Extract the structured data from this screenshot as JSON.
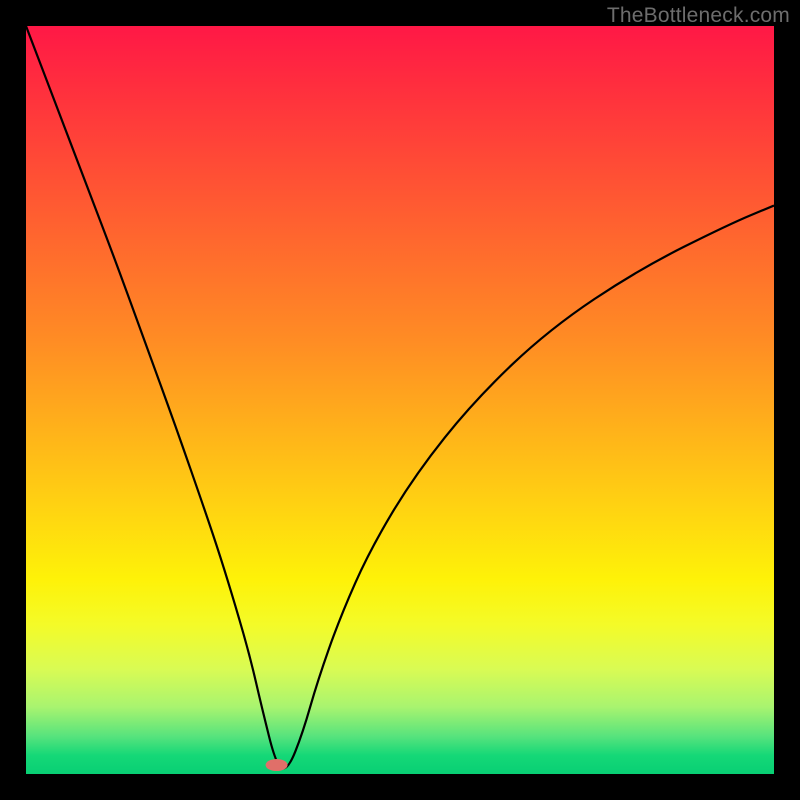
{
  "watermark": "TheBottleneck.com",
  "chart_data": {
    "type": "line",
    "title": "",
    "xlabel": "",
    "ylabel": "",
    "xlim": [
      0,
      100
    ],
    "ylim": [
      0,
      100
    ],
    "grid": false,
    "series": [
      {
        "name": "curve",
        "x": [
          0,
          4,
          8,
          12,
          16,
          20,
          24,
          26,
          28,
          30,
          31.5,
          33.5,
          35,
          37,
          39,
          42,
          46,
          52,
          60,
          70,
          82,
          94,
          100
        ],
        "y": [
          100,
          89.5,
          79,
          68.5,
          57.5,
          46.5,
          35,
          29,
          22.5,
          15.5,
          9,
          1,
          0.5,
          5.5,
          12.5,
          21,
          30,
          40,
          50,
          59.5,
          67.5,
          73.5,
          76
        ]
      }
    ],
    "marker": {
      "x": 33.5,
      "y": 1.2,
      "color": "#e06f69"
    },
    "background_gradient": [
      "#ff1846",
      "#ffd511",
      "#08cf74"
    ]
  }
}
